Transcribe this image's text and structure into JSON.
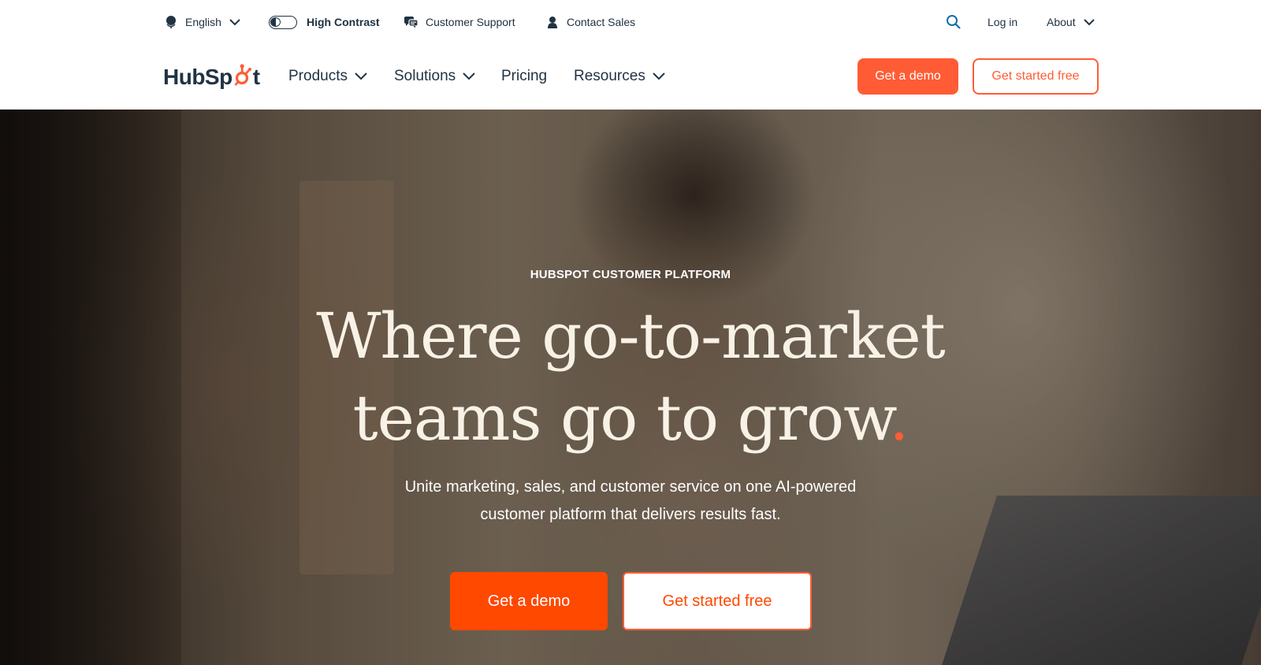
{
  "colors": {
    "accent": "#ff5c35",
    "accent_strong": "#ff4800",
    "text_dark": "#213343",
    "hero_text": "#f8f1e6"
  },
  "utility_bar": {
    "language": {
      "label": "English",
      "icon": "globe-icon"
    },
    "high_contrast": {
      "label": "High Contrast",
      "icon": "toggle-icon"
    },
    "customer_support": {
      "label": "Customer Support",
      "icon": "chat-bubbles-icon"
    },
    "contact_sales": {
      "label": "Contact Sales",
      "icon": "person-icon"
    },
    "search": {
      "icon": "search-icon"
    },
    "login": {
      "label": "Log in"
    },
    "about": {
      "label": "About"
    }
  },
  "main_nav": {
    "logo_text_1": "HubSp",
    "logo_text_2": "t",
    "items": [
      {
        "label": "Products"
      },
      {
        "label": "Solutions"
      },
      {
        "label": "Pricing"
      },
      {
        "label": "Resources"
      }
    ],
    "demo_button": "Get a demo",
    "free_button": "Get started free"
  },
  "hero": {
    "eyebrow": "HUBSPOT CUSTOMER PLATFORM",
    "title_line1": "Where go-to-market",
    "title_line2": "teams go to grow",
    "title_dot": ".",
    "subtitle_line1": "Unite marketing, sales, and customer service on one AI-powered",
    "subtitle_line2": "customer platform that delivers results fast.",
    "demo_button": "Get a demo",
    "free_button": "Get started free"
  }
}
